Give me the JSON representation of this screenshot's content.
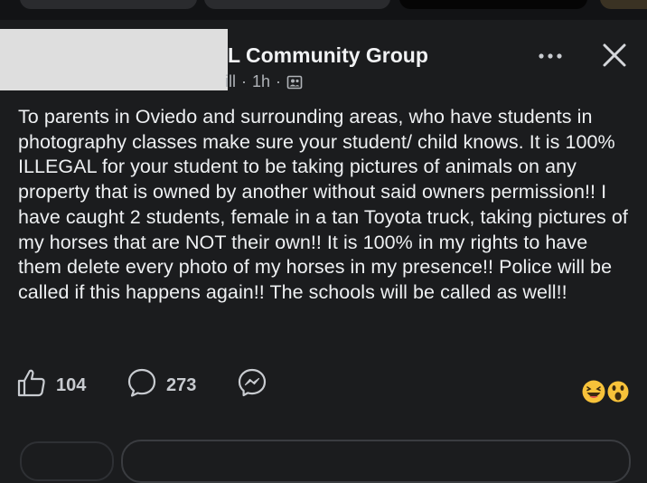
{
  "header": {
    "group_name": "L Community Group",
    "author_fragment": "ill",
    "time": "1h",
    "separator": "·"
  },
  "post": {
    "text": "To parents in Oviedo and surrounding areas, who have students in photography classes make sure your student/ child knows. It is 100% ILLEGAL for your student to be taking pictures of animals on any property that is owned by another without said owners permission!! I have caught 2 students, female in a tan Toyota truck, taking pictures of my horses that are NOT their own!! It is 100% in my rights to have them delete every photo of my horses in my presence!! Police will be called if this happens again!! The schools  will be called as well!!"
  },
  "actions": {
    "likes": "104",
    "comments": "273"
  },
  "icons": {
    "privacy": "group-members-icon",
    "more": "more-options-icon",
    "close": "close-icon",
    "like": "thumbs-up-icon",
    "comment": "comment-bubble-icon",
    "share": "messenger-icon",
    "reactions": [
      "laughing-face-icon",
      "surprised-face-icon"
    ]
  },
  "colors": {
    "background": "#1b1c1e",
    "text": "#e8eaed",
    "secondary_text": "#b0b3b8"
  }
}
